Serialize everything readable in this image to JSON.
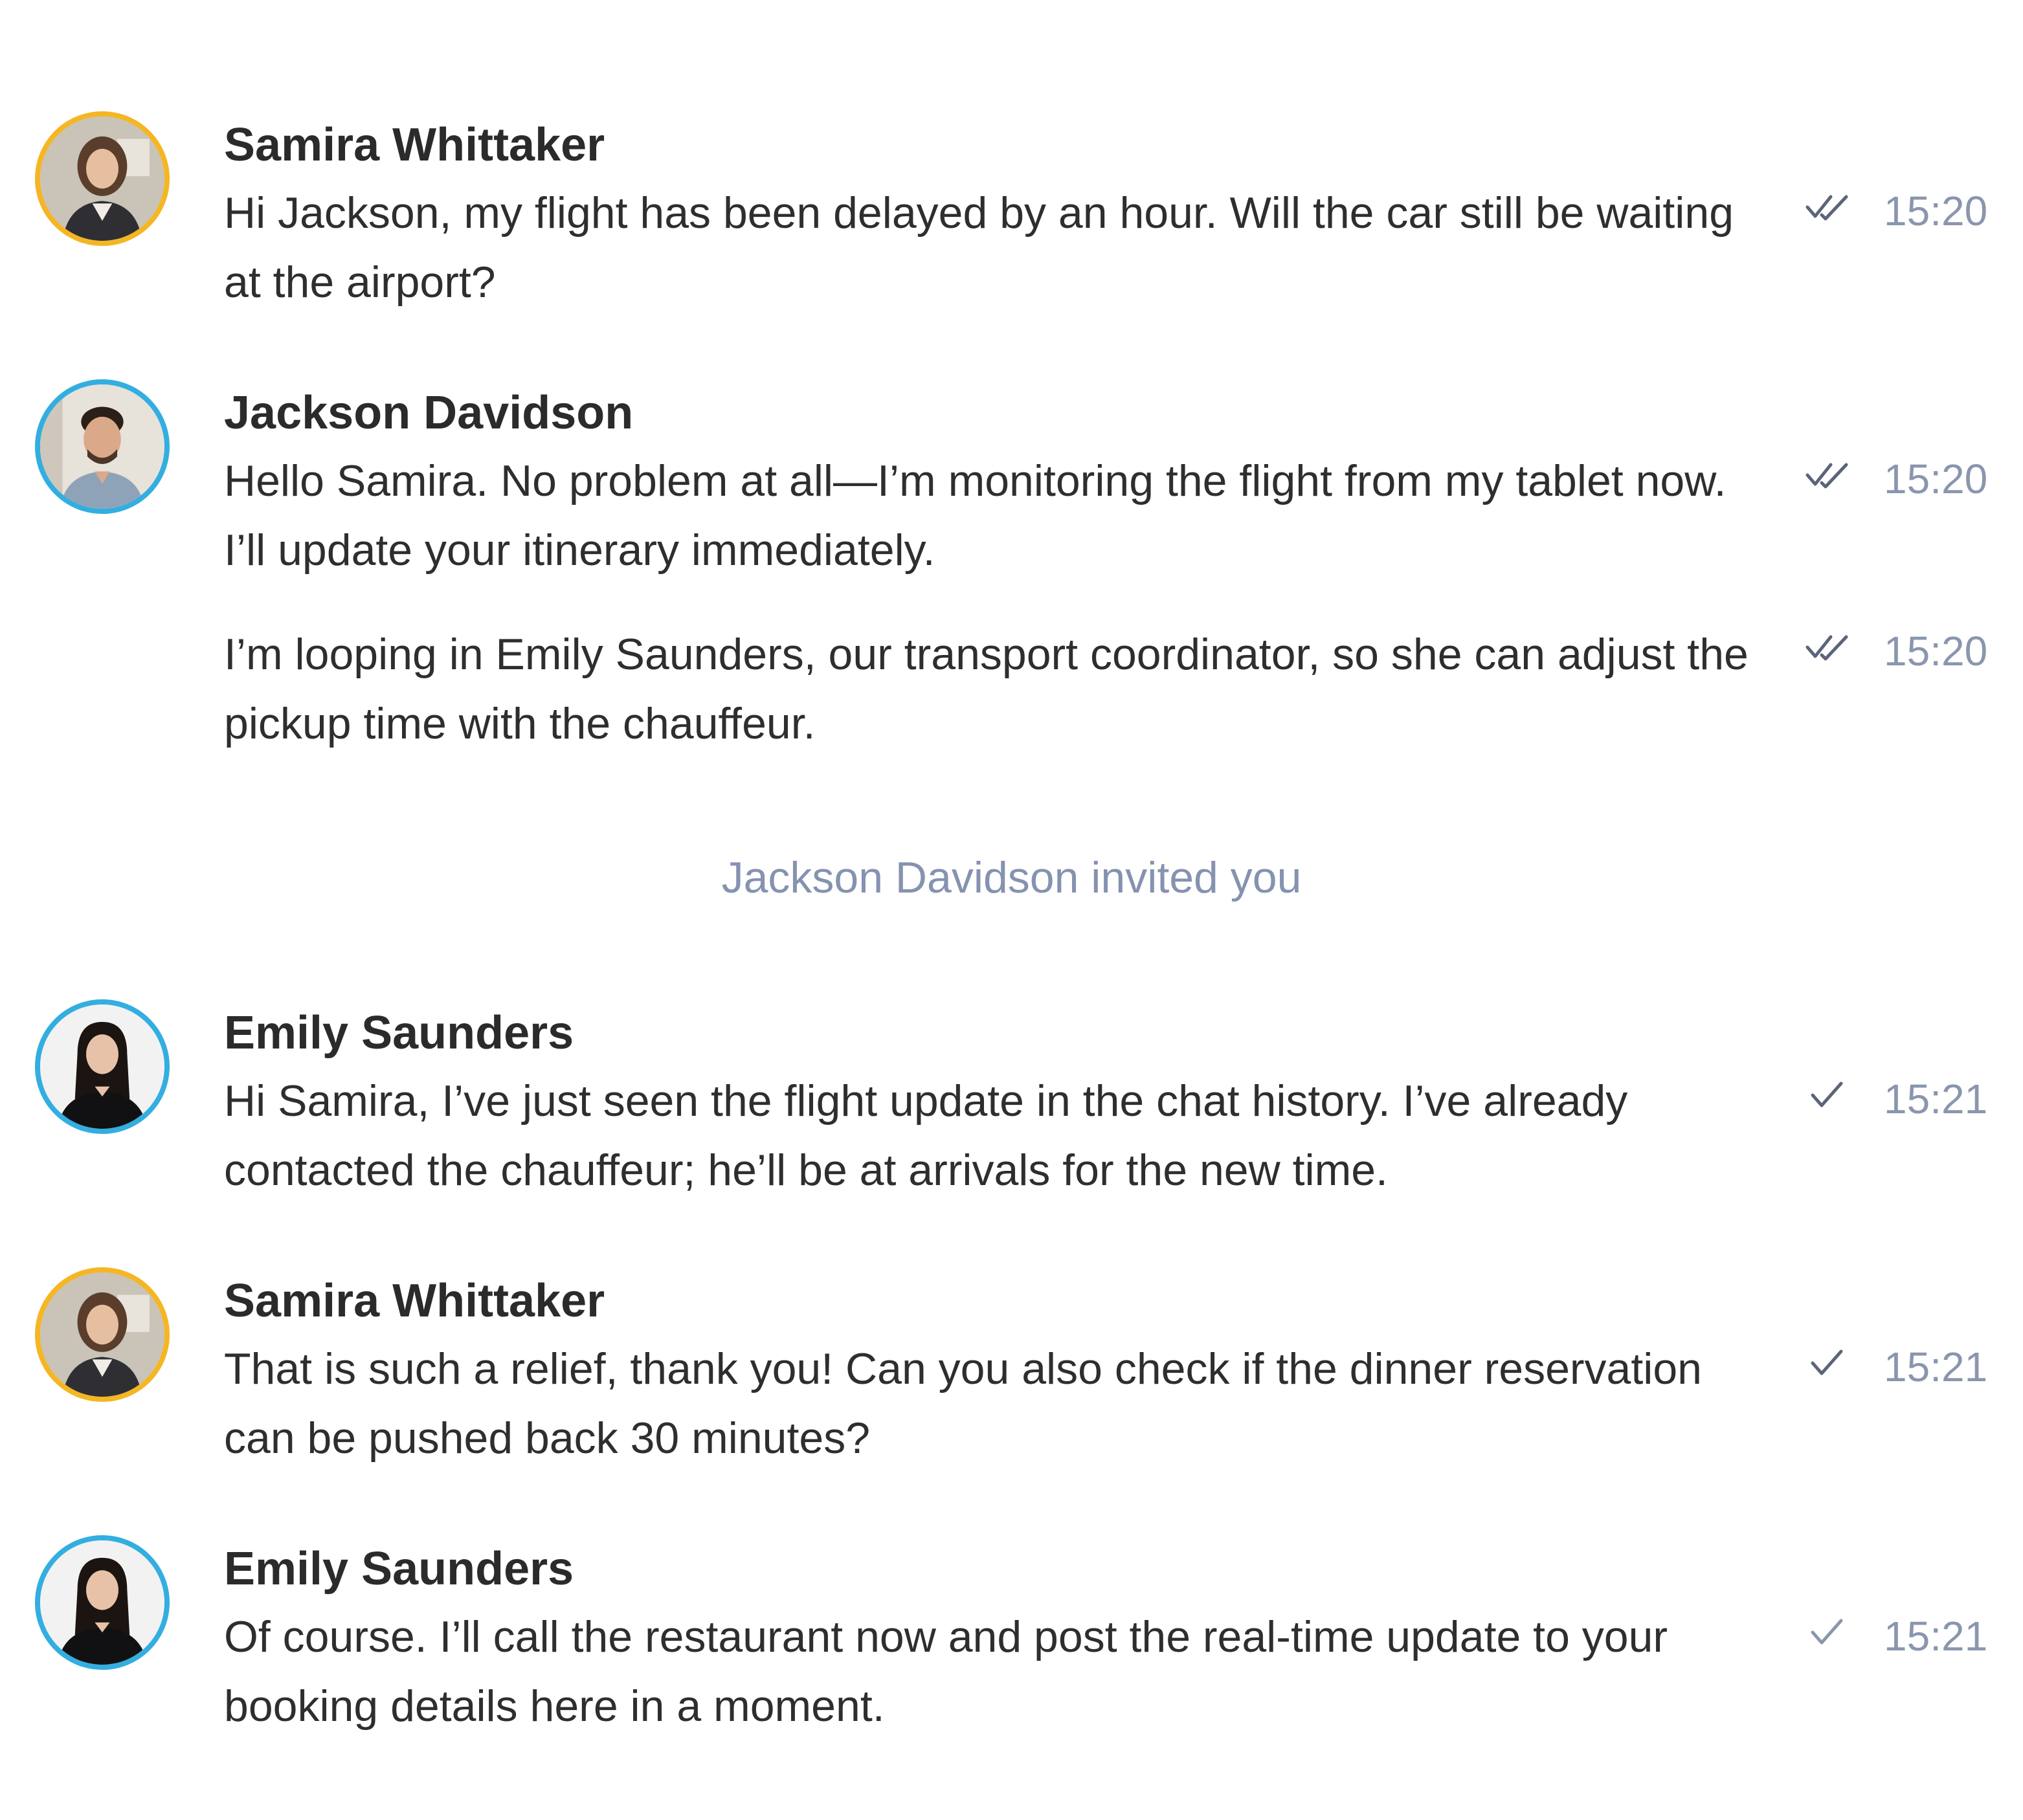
{
  "colors": {
    "avatar_ring_samira": "#f5b623",
    "avatar_ring_team": "#33aee0",
    "timestamp": "#8a96ad",
    "system_note": "#8592b0",
    "text": "#2e2e2e"
  },
  "messages": [
    {
      "sender": "Samira Whittaker",
      "text": "Hi Jackson, my flight has been delayed by an hour. Will the car still be waiting at the airport?",
      "time": "15:20",
      "status_icon": "double-check-icon"
    },
    {
      "sender": "Jackson Davidson",
      "text": "Hello Samira. No problem at all—I’m monitoring the flight from my tablet now. I’ll update your itinerary immediately.",
      "time": "15:20",
      "status_icon": "double-check-icon"
    },
    {
      "text": "I’m looping in Emily Saunders, our transport coordinator, so she can adjust the pickup time with the chauffeur.",
      "time": "15:20",
      "status_icon": "double-check-icon"
    },
    {
      "sender": "Emily Saunders",
      "text": "Hi Samira, I’ve just seen the flight update in the chat history. I’ve already contacted the chauffeur; he’ll be at arrivals for the new time.",
      "time": "15:21",
      "status_icon": "check-icon"
    },
    {
      "sender": "Samira Whittaker",
      "text": "That is such a relief, thank you! Can you also check if the dinner reservation can be pushed back 30 minutes?",
      "time": "15:21",
      "status_icon": "check-icon"
    },
    {
      "sender": "Emily Saunders",
      "text": "Of course. I’ll call the restaurant now and post the real-time update to your booking details here in a moment.",
      "time": "15:21",
      "status_icon": "check-icon"
    }
  ],
  "system_note": "Jackson Davidson invited you"
}
